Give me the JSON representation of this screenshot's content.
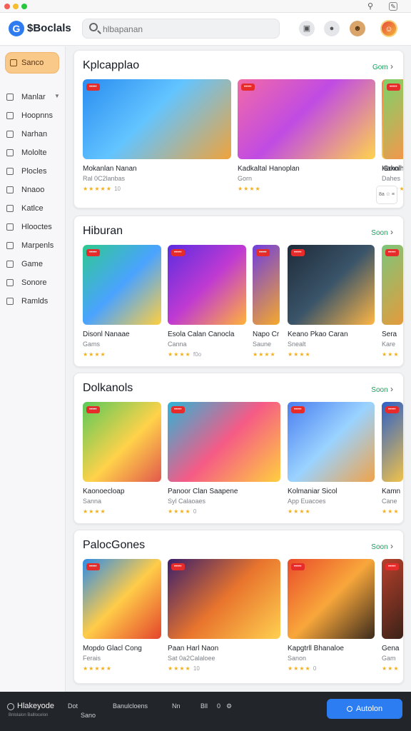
{
  "header": {
    "logo_mark": "G",
    "logo_text": "$Boclals",
    "search_placeholder": "hlbapanan",
    "search_value": ""
  },
  "sidebar": {
    "active_label": "Sanco",
    "items": [
      {
        "label": "Manlar",
        "icon": "compass-icon",
        "has_chevron": true
      },
      {
        "label": "Hoopnns",
        "icon": "book-icon"
      },
      {
        "label": "Narhan",
        "icon": "clock-icon"
      },
      {
        "label": "Mololte",
        "icon": "phone-icon"
      },
      {
        "label": "Plocles",
        "icon": "monitor-icon"
      },
      {
        "label": "Nnaoo",
        "icon": "chart-icon"
      },
      {
        "label": "Katlce",
        "icon": "user-icon"
      },
      {
        "label": "Hlooctes",
        "icon": "archive-icon"
      },
      {
        "label": "Marpenls",
        "icon": "puzzle-icon"
      },
      {
        "label": "Game",
        "icon": "layers-icon"
      },
      {
        "label": "Sonore",
        "icon": "disc-icon"
      },
      {
        "label": "Ramlds",
        "icon": "grid-icon"
      }
    ]
  },
  "sections": [
    {
      "title": "Kplcapplao",
      "link": "Gom",
      "cards": [
        {
          "name": "Mokanlan Nanan",
          "cat": "Ral 0C2lanbas",
          "stars": "★★★★★",
          "num": "10",
          "badge": "",
          "art": "a1"
        },
        {
          "name": "Kadkaltal Hanoplan",
          "cat": "Gorn",
          "stars": "★★★★",
          "num": "",
          "badge": "",
          "art": "a2"
        },
        {
          "name": "Hakolhan",
          "cat": "Dahes",
          "stars": "★★★★",
          "num": "",
          "badge": "",
          "art": "a3"
        },
        {
          "name": "Grnn",
          "cat": "",
          "stars": "",
          "num": "",
          "badge": "",
          "art": "a4"
        }
      ],
      "more": "8a ☆ ≡"
    },
    {
      "title": "Hiburan",
      "link": "Soon",
      "cards": [
        {
          "name": "Disonl Nanaae",
          "cat": "Gams",
          "stars": "★★★★",
          "num": "",
          "badge": "",
          "art": "b1"
        },
        {
          "name": "Esola Calan Canocla",
          "cat": "Canna",
          "stars": "★★★★",
          "num": "f0o",
          "badge": "",
          "art": "b2"
        },
        {
          "name": "Napo Cr",
          "cat": "Saune",
          "stars": "★★★★",
          "num": "",
          "badge": "",
          "art": "b3"
        },
        {
          "name": "Keano Pkao Caran",
          "cat": "Snealt",
          "stars": "★★★★",
          "num": "",
          "badge": "",
          "art": "b4"
        },
        {
          "name": "Sera",
          "cat": "Kare",
          "stars": "★★★",
          "num": "",
          "badge": "",
          "art": "b5"
        }
      ]
    },
    {
      "title": "Dolkanols",
      "link": "Soon",
      "cards": [
        {
          "name": "Kaonoecloap",
          "cat": "Sanna",
          "stars": "★★★★",
          "num": "",
          "badge": "",
          "art": "c1"
        },
        {
          "name": "Panoor Clan Saapene",
          "cat": "Syl Calaoaes",
          "stars": "★★★★",
          "num": "0",
          "badge": "",
          "art": "c2"
        },
        {
          "name": "Kolmaniar Sicol",
          "cat": "App Euacoes",
          "stars": "★★★★",
          "num": "",
          "badge": "",
          "art": "c3"
        },
        {
          "name": "Kamn",
          "cat": "Cane",
          "stars": "★★★",
          "num": "",
          "badge": "",
          "art": "c4"
        }
      ]
    },
    {
      "title": "PalocGones",
      "link": "Soon",
      "cards": [
        {
          "name": "Mopdo Glacl Cong",
          "cat": "Ferais",
          "stars": "★★★★★",
          "num": "",
          "badge": "",
          "art": "d1"
        },
        {
          "name": "Paan Harl Naon",
          "cat": "Sat 0a2Calaloee",
          "stars": "★★★★",
          "num": "10",
          "badge": "",
          "art": "d2"
        },
        {
          "name": "Kapgtrll Bhanaloe",
          "cat": "Sanon",
          "stars": "★★★★",
          "num": "0",
          "badge": "",
          "art": "d3"
        },
        {
          "name": "Gena",
          "cat": "Gam",
          "stars": "★★★",
          "num": "",
          "badge": "",
          "art": "d4"
        }
      ]
    }
  ],
  "bottom": {
    "brand": "Hlakeyode",
    "sub": "Bnlolalon Balllocelon",
    "items": [
      "Dot",
      "Sano",
      "Banulcloens",
      "Nn",
      "Bll",
      "0"
    ],
    "cta": "Autolon"
  }
}
